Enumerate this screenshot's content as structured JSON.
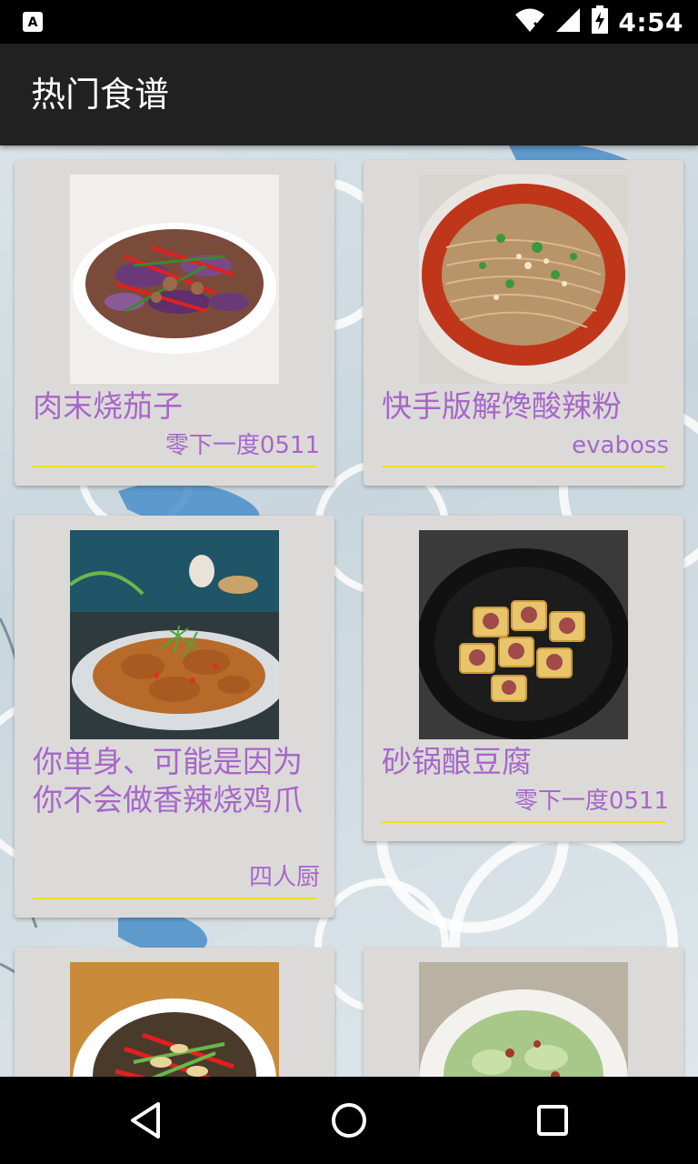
{
  "status_bar": {
    "time": "4:54",
    "icons": [
      "notification-a-icon",
      "wifi-icon",
      "cell-signal-icon",
      "battery-charging-icon"
    ]
  },
  "toolbar": {
    "title": "热门食谱"
  },
  "recipes": [
    {
      "title": "肉末烧茄子",
      "author": "零下一度0511",
      "image": "braised-eggplant-photo"
    },
    {
      "title": "快手版解馋酸辣粉",
      "author": "evaboss",
      "image": "hot-sour-noodles-photo"
    },
    {
      "title": "你单身、可能是因为你不会做香辣烧鸡爪",
      "author": "四人厨",
      "image": "spicy-chicken-feet-photo"
    },
    {
      "title": "砂锅酿豆腐",
      "author": "零下一度0511",
      "image": "stuffed-tofu-claypot-photo"
    },
    {
      "title": "",
      "author": "",
      "image": "stir-fry-mushroom-photo"
    },
    {
      "title": "",
      "author": "",
      "image": "cabbage-stir-fry-photo"
    }
  ],
  "colors": {
    "accent_text": "#a667c9",
    "divider": "#f3dd12",
    "card_bg": "#dcdad9",
    "toolbar_bg": "#212121"
  },
  "nav_bar": {
    "buttons": [
      "back-icon",
      "home-icon",
      "recents-icon"
    ]
  }
}
